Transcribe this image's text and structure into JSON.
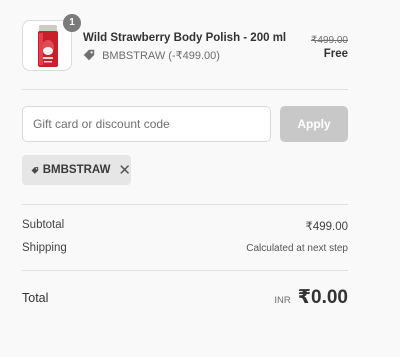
{
  "product": {
    "quantity": "1",
    "name": "Wild Strawberry Body Polish - 200 ml",
    "discount_text": "BMBSTRAW (-₹499.00)",
    "original_price": "₹499.00",
    "final_price": "Free",
    "image_icon": "body-polish-tube-thumbnail"
  },
  "discount_form": {
    "placeholder": "Gift card or discount code",
    "value": "",
    "apply_label": "Apply"
  },
  "applied_code": {
    "code": "BMBSTRAW",
    "remove_symbol": "✕"
  },
  "summary": {
    "subtotal_label": "Subtotal",
    "subtotal_value": "₹499.00",
    "shipping_label": "Shipping",
    "shipping_value": "Calculated at next step",
    "total_label": "Total",
    "currency": "INR",
    "total_value": "₹0.00"
  },
  "colors": {
    "background": "#f9f9f9",
    "apply_button_disabled": "#c8c8c8",
    "chip_background": "#e6e6e6",
    "badge": "#7b7b7b"
  }
}
